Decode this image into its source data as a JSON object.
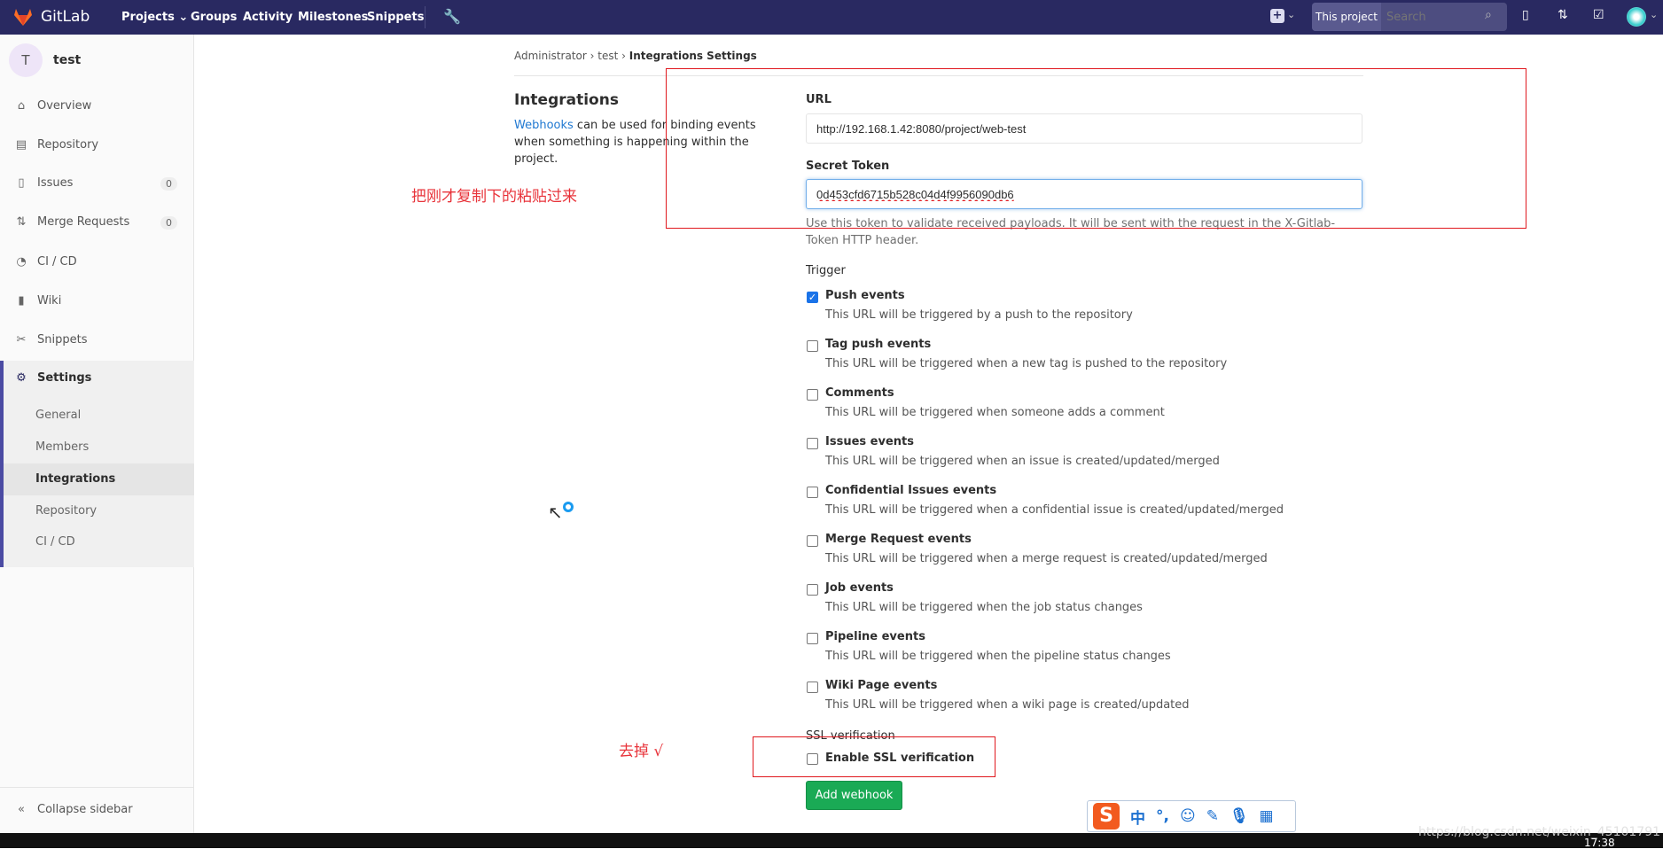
{
  "topbar": {
    "brand": "GitLab",
    "nav": [
      "Projects",
      "Groups",
      "Activity",
      "Milestones",
      "Snippets"
    ],
    "scope": "This project",
    "search_placeholder": "Search"
  },
  "sidebar": {
    "project_initial": "T",
    "project_name": "test",
    "items": [
      {
        "label": "Overview",
        "icon": "home-icon"
      },
      {
        "label": "Repository",
        "icon": "doc-icon"
      },
      {
        "label": "Issues",
        "icon": "issues-icon",
        "count": "0"
      },
      {
        "label": "Merge Requests",
        "icon": "merge-request-icon",
        "count": "0"
      },
      {
        "label": "CI / CD",
        "icon": "rocket-icon"
      },
      {
        "label": "Wiki",
        "icon": "book-icon"
      },
      {
        "label": "Snippets",
        "icon": "scissors-icon"
      },
      {
        "label": "Settings",
        "icon": "gear-icon"
      }
    ],
    "sub": [
      "General",
      "Members",
      "Integrations",
      "Repository",
      "CI / CD"
    ],
    "collapse": "Collapse sidebar"
  },
  "breadcrumb": [
    "Administrator",
    "test",
    "Integrations Settings"
  ],
  "intro": {
    "title": "Integrations",
    "link": "Webhooks",
    "text": " can be used for binding events when something is happening within the project."
  },
  "form": {
    "url_label": "URL",
    "url_value": "http://192.168.1.42:8080/project/web-test",
    "token_label": "Secret Token",
    "token_value": "0d453cfd6715b528c04d4f9956090db6",
    "token_help": "Use this token to validate received payloads. It will be sent with the request in the X-Gitlab-Token HTTP header.",
    "trigger_label": "Trigger",
    "triggers": [
      {
        "label": "Push events",
        "desc": "This URL will be triggered by a push to the repository",
        "checked": true
      },
      {
        "label": "Tag push events",
        "desc": "This URL will be triggered when a new tag is pushed to the repository",
        "checked": false
      },
      {
        "label": "Comments",
        "desc": "This URL will be triggered when someone adds a comment",
        "checked": false
      },
      {
        "label": "Issues events",
        "desc": "This URL will be triggered when an issue is created/updated/merged",
        "checked": false
      },
      {
        "label": "Confidential Issues events",
        "desc": "This URL will be triggered when a confidential issue is created/updated/merged",
        "checked": false
      },
      {
        "label": "Merge Request events",
        "desc": "This URL will be triggered when a merge request is created/updated/merged",
        "checked": false
      },
      {
        "label": "Job events",
        "desc": "This URL will be triggered when the job status changes",
        "checked": false
      },
      {
        "label": "Pipeline events",
        "desc": "This URL will be triggered when the pipeline status changes",
        "checked": false
      },
      {
        "label": "Wiki Page events",
        "desc": "This URL will be triggered when a wiki page is created/updated",
        "checked": false
      }
    ],
    "ssl_label": "SSL verification",
    "ssl_option": "Enable SSL verification",
    "ssl_checked": false,
    "submit": "Add webhook"
  },
  "annotations": {
    "paste": "把刚才复制下的粘贴过来",
    "uncheck": "去掉 √"
  },
  "ime": {
    "items": [
      "中",
      "°,"
    ]
  },
  "watermark": "https://blog.csdn.net/weixin_45101791",
  "clock": "17:38",
  "colors": {
    "topbar": "#292961",
    "accent": "#4b4ba3",
    "submit": "#1aaa55",
    "annotation": "#e0181e"
  }
}
